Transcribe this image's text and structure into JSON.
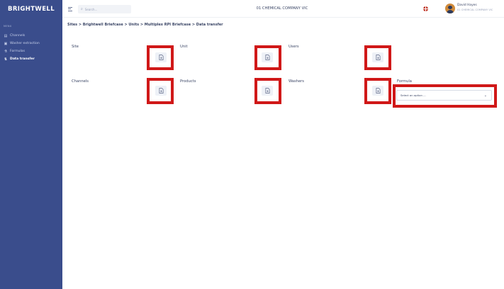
{
  "sidebar": {
    "brand": "BRIGHTWELL",
    "menu_header": "MENU",
    "items": [
      {
        "label": "Channels",
        "icon": "channels-icon"
      },
      {
        "label": "Washer extraction",
        "icon": "washer-icon"
      },
      {
        "label": "Formulas",
        "icon": "formulas-icon"
      },
      {
        "label": "Data transfer",
        "icon": "transfer-icon",
        "active": true
      }
    ]
  },
  "topbar": {
    "search_placeholder": "Search...",
    "company": "01 CHEMICAL COMPANY VIC",
    "user_name": "David Hayes",
    "user_company": "01 CHEMICAL COMPANY VIC"
  },
  "breadcrumb": "Sites > Brightwell Briefcase > Units > Multiplex RPI Briefcase > Data transfer",
  "cards": {
    "site": "Site",
    "unit": "Unit",
    "users": "Users",
    "channels": "Channels",
    "products": "Products",
    "washers": "Washers",
    "formula": "Formula"
  },
  "formula_select": {
    "placeholder": "Select an option ..."
  },
  "colors": {
    "sidebar_bg": "#3a4d8c",
    "highlight": "#d01818"
  }
}
